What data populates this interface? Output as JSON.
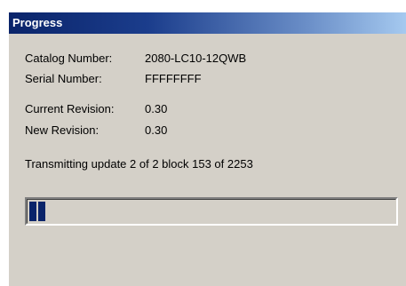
{
  "window": {
    "title": "Progress"
  },
  "fields": [
    {
      "label": "Catalog Number:",
      "value": "2080-LC10-12QWB"
    },
    {
      "label": "Serial Number:",
      "value": "FFFFFFFF"
    },
    {
      "label": "Current Revision:",
      "value": "0.30"
    },
    {
      "label": "New Revision:",
      "value": "0.30"
    }
  ],
  "status": "Transmitting update 2 of 2  block 153 of 2253",
  "progress": {
    "filled_blocks": 2,
    "fraction": 0.0679
  },
  "colors": {
    "window_bg": "#d4d0c8",
    "titlebar_start": "#0a246a",
    "titlebar_end": "#a6caf0",
    "progress_fill": "#0a246a"
  }
}
